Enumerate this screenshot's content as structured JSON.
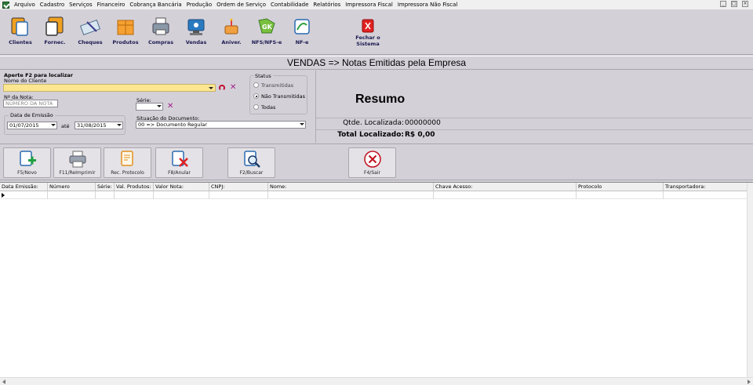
{
  "menu": [
    "Arquivo",
    "Cadastro",
    "Serviços",
    "Financeiro",
    "Cobrança Bancária",
    "Produção",
    "Ordem de Serviço",
    "Contabilidade",
    "Relatórios",
    "Impressora Fiscal",
    "Impressora Não Fiscal"
  ],
  "toolbar": {
    "clientes": "Clientes",
    "fornec": "Fornec.",
    "cheques": "Cheques",
    "produtos": "Produtos",
    "compras": "Compras",
    "vendas": "Vendas",
    "aniver": "Aniver.",
    "nfs": "NFS/NFS-e",
    "nfe": "NF-e",
    "fechar_line1": "Fechar o",
    "fechar_line2": "Sistema"
  },
  "title": "VENDAS   => Notas Emitidas pela Empresa",
  "filters": {
    "hint": "Aperte F2 para localizar",
    "client_label": "Nome do Cliente",
    "client_value": "",
    "nota_label": "Nº da Nota:",
    "nota_placeholder": "NÚMERO DA NOTA",
    "serie_label": "Série:",
    "serie_value": "",
    "emissao_label": "Data de Emissão",
    "date_from": "01/07/2015",
    "ate_label": "até",
    "date_to": "31/08/2015",
    "situacao_label": "Situação do Documento:",
    "situacao_value": "00 => Documento Regular"
  },
  "status": {
    "title": "Status",
    "opt_transmitidas": "Transmitidas",
    "opt_nao_transmitidas": "Não Transmitidas",
    "opt_todas": "Todas",
    "selected": "Não Transmitidas"
  },
  "summary": {
    "title": "Resumo",
    "qtde_label": "Qtde. Localizada:",
    "qtde_value": "00000000",
    "total_label": "Total Localizado:",
    "total_value": "R$ 0,00"
  },
  "actions": {
    "novo": "F5/Novo",
    "reimprimir": "F11/ReImprimir",
    "protocolo": "Rec. Protocolo",
    "anular": "F8/Anular",
    "buscar": "F2/Buscar",
    "sair": "F4/Sair"
  },
  "grid": {
    "columns": [
      "Data Emissão:",
      "Número",
      "Série:",
      "Val. Produtos:",
      "Valor Nota:",
      "CNPJ:",
      "Nome:",
      "Chave Acesso:",
      "Protocolo",
      "Transportadora:"
    ]
  },
  "colors": {
    "window_bg": "#d4d0d8",
    "client_field": "#fde690",
    "clear_icon": "#a0208a",
    "close_red": "#e02020"
  }
}
